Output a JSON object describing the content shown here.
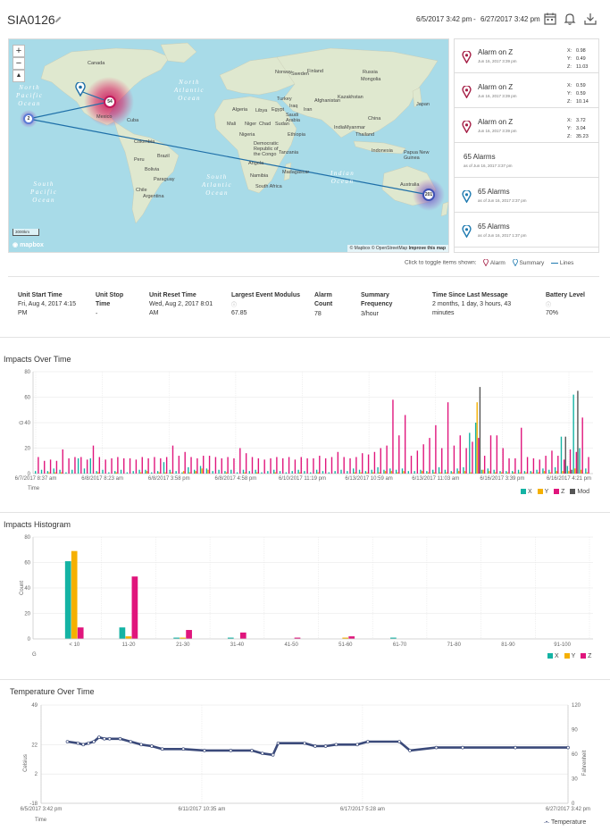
{
  "header": {
    "title": "SIA0126",
    "date_start": "6/5/2017 3:42 pm",
    "date_sep": "-",
    "date_end": "6/27/2017 3:42 pm"
  },
  "map": {
    "zoom_in": "+",
    "zoom_out": "−",
    "north": "▲",
    "scale": "3000km",
    "logo": "mapbox",
    "attribution": "© Mapbox © OpenStreetMap",
    "improve": "Improve this map",
    "clusters": [
      "54",
      "2",
      "201"
    ],
    "oceans": [
      {
        "text": "North\nPacific\nOcean",
        "x": 8,
        "y": 50
      },
      {
        "text": "North\nAtlantic\nOcean",
        "x": 185,
        "y": 44
      },
      {
        "text": "South\nPacific\nOcean",
        "x": 24,
        "y": 158
      },
      {
        "text": "South\nAtlantic\nOcean",
        "x": 216,
        "y": 150
      },
      {
        "text": "Indian\nOcean",
        "x": 360,
        "y": 146
      }
    ],
    "countries": [
      {
        "t": "Canada",
        "x": 88,
        "y": 24
      },
      {
        "t": "Mexico",
        "x": 98,
        "y": 84
      },
      {
        "t": "Cuba",
        "x": 132,
        "y": 88
      },
      {
        "t": "Colombia",
        "x": 140,
        "y": 112
      },
      {
        "t": "Peru",
        "x": 140,
        "y": 132
      },
      {
        "t": "Brazil",
        "x": 166,
        "y": 128
      },
      {
        "t": "Bolivia",
        "x": 152,
        "y": 143
      },
      {
        "t": "Paraguay",
        "x": 162,
        "y": 154
      },
      {
        "t": "Chile",
        "x": 142,
        "y": 166
      },
      {
        "t": "Argentina",
        "x": 150,
        "y": 173
      },
      {
        "t": "Norway",
        "x": 298,
        "y": 34
      },
      {
        "t": "Sweden",
        "x": 316,
        "y": 36
      },
      {
        "t": "Finland",
        "x": 334,
        "y": 33
      },
      {
        "t": "Russia",
        "x": 396,
        "y": 34
      },
      {
        "t": "Kazakhstan",
        "x": 368,
        "y": 62
      },
      {
        "t": "Mongolia",
        "x": 394,
        "y": 42
      },
      {
        "t": "China",
        "x": 402,
        "y": 86
      },
      {
        "t": "Turkey",
        "x": 300,
        "y": 64
      },
      {
        "t": "Afghanistan",
        "x": 342,
        "y": 66
      },
      {
        "t": "Iran",
        "x": 330,
        "y": 76
      },
      {
        "t": "Iraq",
        "x": 314,
        "y": 72
      },
      {
        "t": "Algeria",
        "x": 250,
        "y": 76
      },
      {
        "t": "Libya",
        "x": 276,
        "y": 77
      },
      {
        "t": "Egypt",
        "x": 294,
        "y": 76
      },
      {
        "t": "Saudi\nArabia",
        "x": 310,
        "y": 82
      },
      {
        "t": "India",
        "x": 364,
        "y": 96
      },
      {
        "t": "Mali",
        "x": 244,
        "y": 92
      },
      {
        "t": "Niger",
        "x": 264,
        "y": 92
      },
      {
        "t": "Chad",
        "x": 280,
        "y": 92
      },
      {
        "t": "Sudan",
        "x": 298,
        "y": 92
      },
      {
        "t": "Nigeria",
        "x": 258,
        "y": 104
      },
      {
        "t": "Ethiopia",
        "x": 312,
        "y": 104
      },
      {
        "t": "Democratic\nRepublic of\nthe Congo",
        "x": 274,
        "y": 114
      },
      {
        "t": "Tanzania",
        "x": 302,
        "y": 124
      },
      {
        "t": "Angola",
        "x": 268,
        "y": 136
      },
      {
        "t": "Namibia",
        "x": 270,
        "y": 150
      },
      {
        "t": "South Africa",
        "x": 276,
        "y": 162
      },
      {
        "t": "Madagascar",
        "x": 306,
        "y": 146
      },
      {
        "t": "Indonesia",
        "x": 406,
        "y": 122
      },
      {
        "t": "Thailand",
        "x": 388,
        "y": 104
      },
      {
        "t": "Myanmar",
        "x": 376,
        "y": 96
      },
      {
        "t": "Japan",
        "x": 456,
        "y": 70
      },
      {
        "t": "Papua New\nGuinea",
        "x": 442,
        "y": 124
      },
      {
        "t": "Australia",
        "x": 438,
        "y": 160
      }
    ]
  },
  "alarms": [
    {
      "title": "Alarm on Z",
      "sub": "Jun 16, 2017 3:39 pm",
      "x": "0.98",
      "y": "0.49",
      "z": "11.03",
      "color": "#a51f46"
    },
    {
      "title": "Alarm on Z",
      "sub": "Jun 16, 2017 3:39 pm",
      "x": "0.59",
      "y": "0.59",
      "z": "10.14",
      "color": "#a51f46"
    },
    {
      "title": "Alarm on Z",
      "sub": "Jun 16, 2017 3:39 pm",
      "x": "3.72",
      "y": "3.04",
      "z": "35.23",
      "color": "#a51f46"
    },
    {
      "title": "65 Alarms",
      "sub": "as of Jun 16, 2017 3:37 pm",
      "color": ""
    },
    {
      "title": "65 Alarms",
      "sub": "as of Jun 16, 2017 2:37 pm",
      "color": "#1e7ab0"
    },
    {
      "title": "65 Alarms",
      "sub": "as of Jun 16, 2017 1:37 pm",
      "color": "#1e7ab0"
    },
    {
      "title": "65 Alarms",
      "sub": "",
      "color": "#1e7ab0"
    }
  ],
  "xyz_labels": {
    "x": "X:",
    "y": "Y:",
    "z": "Z:"
  },
  "toggle": {
    "label": "Click to toggle items shown:",
    "alarm": "Alarm",
    "summary": "Summary",
    "lines": "Lines"
  },
  "info": [
    {
      "label": "Unit Start Time",
      "value": "Fri, Aug 4, 2017 4:15\nPM"
    },
    {
      "label": "Unit Stop\nTime",
      "value": "-"
    },
    {
      "label": "Unit Reset Time",
      "value": "Wed, Aug 2, 2017 8:01\nAM"
    },
    {
      "label": "Largest Event Modulus",
      "value": "67.85",
      "info": true
    },
    {
      "label": "Alarm\nCount",
      "value": "78"
    },
    {
      "label": "Summary\nFrequency",
      "value": "3/hour"
    },
    {
      "label": "Time Since Last Message",
      "value": "2 months, 1 day, 3 hours, 43\nminutes"
    },
    {
      "label": "Battery Level",
      "value": "70%",
      "info": true
    }
  ],
  "colors": {
    "x": "#14b3a4",
    "y": "#f5b000",
    "z": "#e0157c",
    "mod": "#555555",
    "line": "#3b4a7a",
    "alarm": "#a51f46",
    "summary": "#1e7ab0"
  },
  "impacts_over_time": {
    "title": "Impacts Over Time",
    "chart_data": {
      "type": "bar",
      "ylabel": "G",
      "xlabel": "Time",
      "ylim": [
        0,
        80
      ],
      "yticks": [
        0,
        20,
        40,
        60,
        80
      ],
      "xticks": [
        "6/7/2017 8:37 am",
        "6/8/2017 8:23 am",
        "6/8/2017 3:58 pm",
        "6/8/2017 4:58 pm",
        "6/10/2017 11:19 pm",
        "6/13/2017 10:59 am",
        "6/13/2017 11:03 am",
        "6/16/2017 3:39 pm",
        "6/16/2017 4:21 pm"
      ],
      "series_names": [
        "X",
        "Y",
        "Z",
        "Mod"
      ],
      "groups": [
        [
          2,
          0,
          13,
          0
        ],
        [
          3,
          0,
          10,
          0
        ],
        [
          2,
          1,
          11,
          0
        ],
        [
          4,
          1,
          10,
          0
        ],
        [
          3,
          1,
          19,
          0
        ],
        [
          1,
          0,
          12,
          0
        ],
        [
          3,
          0,
          13,
          0
        ],
        [
          12,
          0,
          13,
          0
        ],
        [
          4,
          0,
          11,
          0
        ],
        [
          12,
          0,
          22,
          0
        ],
        [
          2,
          1,
          13,
          0
        ],
        [
          3,
          0,
          11,
          0
        ],
        [
          1,
          0,
          12,
          0
        ],
        [
          2,
          1,
          13,
          0
        ],
        [
          3,
          0,
          12,
          0
        ],
        [
          1,
          0,
          12,
          0
        ],
        [
          2,
          0,
          11,
          0
        ],
        [
          3,
          1,
          13,
          0
        ],
        [
          3,
          2,
          12,
          0
        ],
        [
          1,
          0,
          13,
          0
        ],
        [
          2,
          1,
          12,
          0
        ],
        [
          9,
          1,
          13,
          0
        ],
        [
          3,
          1,
          22,
          0
        ],
        [
          2,
          0,
          14,
          0
        ],
        [
          1,
          2,
          17,
          0
        ],
        [
          5,
          1,
          13,
          0
        ],
        [
          3,
          2,
          12,
          0
        ],
        [
          6,
          4,
          14,
          0
        ],
        [
          4,
          3,
          14,
          0
        ],
        [
          2,
          0,
          13,
          0
        ],
        [
          3,
          0,
          12,
          0
        ],
        [
          2,
          1,
          13,
          0
        ],
        [
          3,
          0,
          12,
          0
        ],
        [
          1,
          0,
          20,
          0
        ],
        [
          3,
          1,
          16,
          0
        ],
        [
          2,
          0,
          13,
          0
        ],
        [
          3,
          1,
          12,
          0
        ],
        [
          1,
          0,
          11,
          0
        ],
        [
          2,
          0,
          12,
          0
        ],
        [
          3,
          1,
          13,
          0
        ],
        [
          2,
          0,
          12,
          0
        ],
        [
          1,
          0,
          13,
          0
        ],
        [
          2,
          0,
          11,
          0
        ],
        [
          3,
          1,
          13,
          0
        ],
        [
          2,
          0,
          12,
          0
        ],
        [
          1,
          0,
          12,
          0
        ],
        [
          3,
          1,
          14,
          0
        ],
        [
          2,
          0,
          12,
          0
        ],
        [
          1,
          0,
          13,
          0
        ],
        [
          2,
          0,
          17,
          0
        ],
        [
          3,
          0,
          13,
          0
        ],
        [
          2,
          0,
          12,
          0
        ],
        [
          4,
          1,
          13,
          0
        ],
        [
          3,
          1,
          16,
          0
        ],
        [
          2,
          1,
          15,
          0
        ],
        [
          3,
          1,
          17,
          0
        ],
        [
          5,
          1,
          20,
          0
        ],
        [
          3,
          2,
          22,
          0
        ],
        [
          4,
          2,
          58,
          0
        ],
        [
          3,
          1,
          30,
          0
        ],
        [
          4,
          2,
          46,
          0
        ],
        [
          2,
          0,
          14,
          0
        ],
        [
          2,
          0,
          18,
          0
        ],
        [
          3,
          2,
          23,
          0
        ],
        [
          2,
          1,
          28,
          0
        ],
        [
          3,
          1,
          38,
          0
        ],
        [
          5,
          1,
          20,
          0
        ],
        [
          3,
          1,
          56,
          0
        ],
        [
          2,
          1,
          22,
          0
        ],
        [
          4,
          2,
          30,
          0
        ],
        [
          5,
          2,
          20,
          0
        ],
        [
          32,
          1,
          25,
          0
        ],
        [
          40,
          56,
          28,
          68
        ],
        [
          3,
          3,
          14,
          0
        ],
        [
          4,
          2,
          30,
          0
        ],
        [
          3,
          1,
          30,
          0
        ],
        [
          2,
          1,
          20,
          0
        ],
        [
          2,
          1,
          12,
          0
        ],
        [
          2,
          1,
          12,
          0
        ],
        [
          3,
          1,
          36,
          0
        ],
        [
          2,
          1,
          13,
          0
        ],
        [
          2,
          1,
          12,
          0
        ],
        [
          3,
          1,
          11,
          0
        ],
        [
          4,
          2,
          14,
          0
        ],
        [
          3,
          1,
          18,
          0
        ],
        [
          5,
          2,
          14,
          0
        ],
        [
          29,
          2,
          11,
          29
        ],
        [
          6,
          2,
          19,
          3
        ],
        [
          62,
          4,
          17,
          65
        ],
        [
          20,
          3,
          44,
          0
        ],
        [
          4,
          1,
          13,
          0
        ]
      ]
    }
  },
  "impacts_histogram": {
    "title": "Impacts Histogram",
    "chart_data": {
      "type": "bar",
      "ylabel": "Count",
      "xlabel": "G",
      "ylim": [
        0,
        80
      ],
      "yticks": [
        0,
        20,
        40,
        60,
        80
      ],
      "categories": [
        "< 10",
        "11-20",
        "21-30",
        "31-40",
        "41-50",
        "51-60",
        "61-70",
        "71-80",
        "81-90",
        "91-100"
      ],
      "series": [
        {
          "name": "X",
          "values": [
            61,
            9,
            1,
            1,
            0,
            0,
            1,
            0,
            0,
            0
          ]
        },
        {
          "name": "Y",
          "values": [
            69,
            2,
            1,
            0,
            0,
            1,
            0,
            0,
            0,
            0
          ]
        },
        {
          "name": "Z",
          "values": [
            9,
            49,
            7,
            5,
            1,
            2,
            0,
            0,
            0,
            0
          ]
        }
      ]
    }
  },
  "temperature": {
    "title": "Temperature Over Time",
    "legend": "Temperature",
    "chart_data": {
      "type": "line",
      "ylabel": "Celsius",
      "y2label": "Fahrenheit",
      "xlabel": "Time",
      "yticks_left": [
        "49",
        "22",
        "2",
        "-18"
      ],
      "yticks_right": [
        "120",
        "90",
        "60",
        "30",
        "0"
      ],
      "xticks": [
        "6/5/2017 3:42 pm",
        "6/11/2017 10:35 am",
        "6/17/2017 5:28 am",
        "6/27/2017 3:42 pm"
      ],
      "ylim": [
        -18,
        49
      ],
      "series": [
        {
          "name": "Temperature",
          "points": [
            [
              0.05,
              24
            ],
            [
              0.07,
              23
            ],
            [
              0.08,
              22
            ],
            [
              0.09,
              23
            ],
            [
              0.1,
              24
            ],
            [
              0.11,
              27
            ],
            [
              0.12,
              26
            ],
            [
              0.13,
              26
            ],
            [
              0.15,
              26
            ],
            [
              0.17,
              24
            ],
            [
              0.19,
              22
            ],
            [
              0.21,
              21
            ],
            [
              0.23,
              19
            ],
            [
              0.27,
              19
            ],
            [
              0.31,
              18
            ],
            [
              0.36,
              18
            ],
            [
              0.4,
              18
            ],
            [
              0.42,
              16
            ],
            [
              0.44,
              15
            ],
            [
              0.45,
              23
            ],
            [
              0.5,
              23
            ],
            [
              0.52,
              21
            ],
            [
              0.54,
              21
            ],
            [
              0.56,
              22
            ],
            [
              0.6,
              22
            ],
            [
              0.62,
              24
            ],
            [
              0.68,
              24
            ],
            [
              0.7,
              18
            ],
            [
              0.75,
              20
            ],
            [
              0.8,
              20
            ],
            [
              0.9,
              20
            ],
            [
              1.0,
              20
            ]
          ]
        }
      ]
    }
  }
}
